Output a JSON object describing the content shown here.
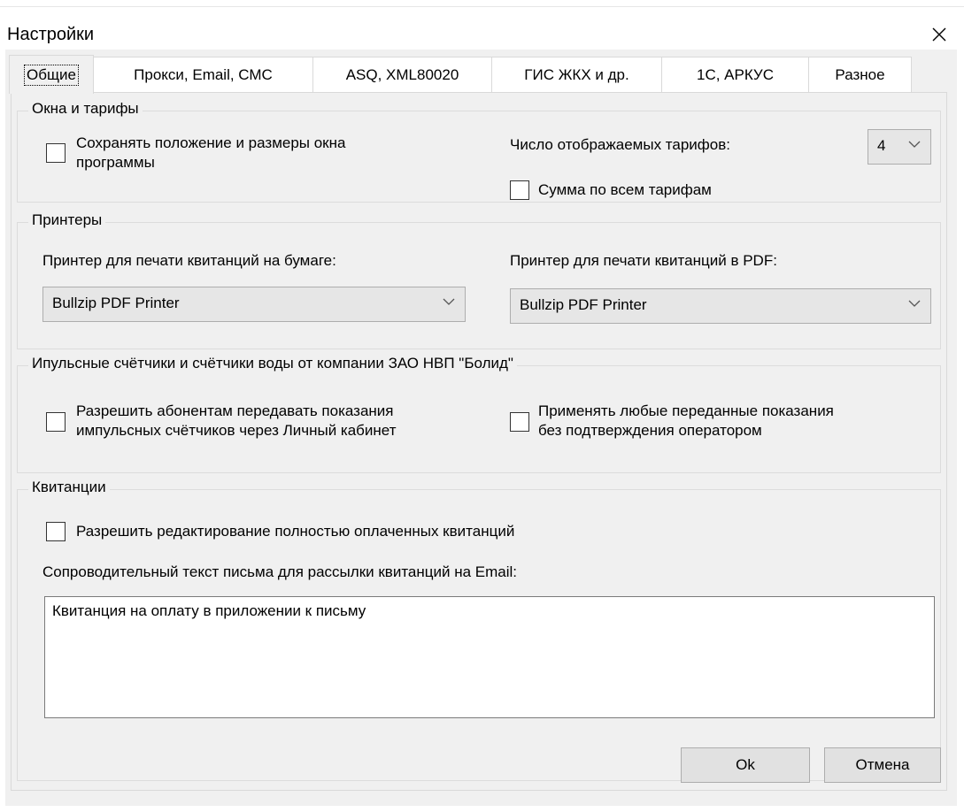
{
  "window": {
    "title": "Настройки"
  },
  "tabs": [
    {
      "label": "Общие"
    },
    {
      "label": "Прокси, Email, СМС"
    },
    {
      "label": "ASQ, XML80020"
    },
    {
      "label": "ГИС ЖКХ и др."
    },
    {
      "label": "1С, АРКУС"
    },
    {
      "label": "Разное"
    }
  ],
  "windows_tariffs": {
    "legend": "Окна и тарифы",
    "save_position_line1": "Сохранять положение и размеры окна",
    "save_position_line2": "программы",
    "save_position_checked": false,
    "tariffs_label": "Число отображаемых тарифов:",
    "tariffs_value": "4",
    "sum_label": "Сумма по всем тарифам",
    "sum_checked": false
  },
  "printers": {
    "legend": "Принтеры",
    "paper_label": "Принтер для печати квитанций на бумаге:",
    "paper_value": "Bullzip PDF Printer",
    "pdf_label": "Принтер для печати квитанций в PDF:",
    "pdf_value": "Bullzip PDF Printer"
  },
  "meters": {
    "legend": "Ипульсные счётчики и счётчики воды от компании ЗАО НВП \"Болид\"",
    "allow_line1": "Разрешить абонентам передавать показания",
    "allow_line2": "импульсных счётчиков через Личный кабинет",
    "allow_checked": false,
    "apply_line1": "Применять любые переданные показания",
    "apply_line2": "без подтверждения оператором",
    "apply_checked": false
  },
  "receipts": {
    "legend": "Квитанции",
    "edit_paid_label": "Разрешить редактирование полностью оплаченных квитанций",
    "edit_paid_checked": false,
    "cover_text_label": "Сопроводительный текст письма для рассылки квитанций на Email:",
    "cover_text_value": "Квитанция на оплату в приложении к письму"
  },
  "buttons": {
    "ok": "Ok",
    "cancel": "Отмена"
  }
}
